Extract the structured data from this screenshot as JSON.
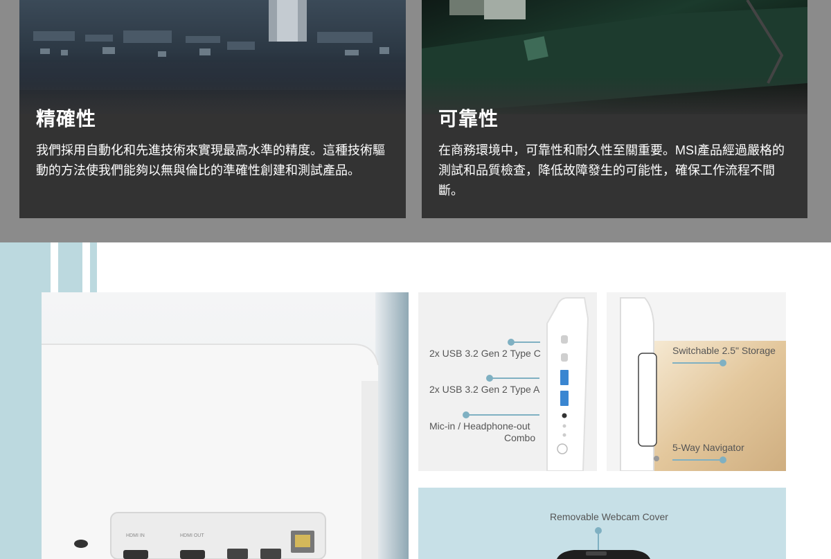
{
  "features": [
    {
      "title": "精確性",
      "body": "我們採用自動化和先進技術來實現最高水準的精度。這種技術驅動的方法使我們能夠以無與倫比的準確性創建和測試產品。"
    },
    {
      "title": "可靠性",
      "body": "在商務環境中，可靠性和耐久性至關重要。MSI產品經過嚴格的測試和品質檢查，降低故障發生的可能性，確保工作流程不間斷。"
    }
  ],
  "ports_panel": {
    "usb_c": "2x USB 3.2 Gen 2 Type C",
    "usb_a": "2x USB 3.2 Gen 2 Type A",
    "mic_line1": "Mic-in / Headphone-out",
    "mic_line2": "Combo"
  },
  "side_panel": {
    "storage": "Switchable 2.5\" Storage",
    "navigator": "5-Way Navigator"
  },
  "webcam_panel": {
    "cover": "Removable Webcam Cover"
  },
  "rear_io": {
    "hdmi_in": "HDMI IN",
    "hdmi_out": "HDMI OUT"
  },
  "colors": {
    "accent": "#7fb0c2",
    "card_bg": "#333333",
    "stripe_blue": "#bcd9df"
  }
}
